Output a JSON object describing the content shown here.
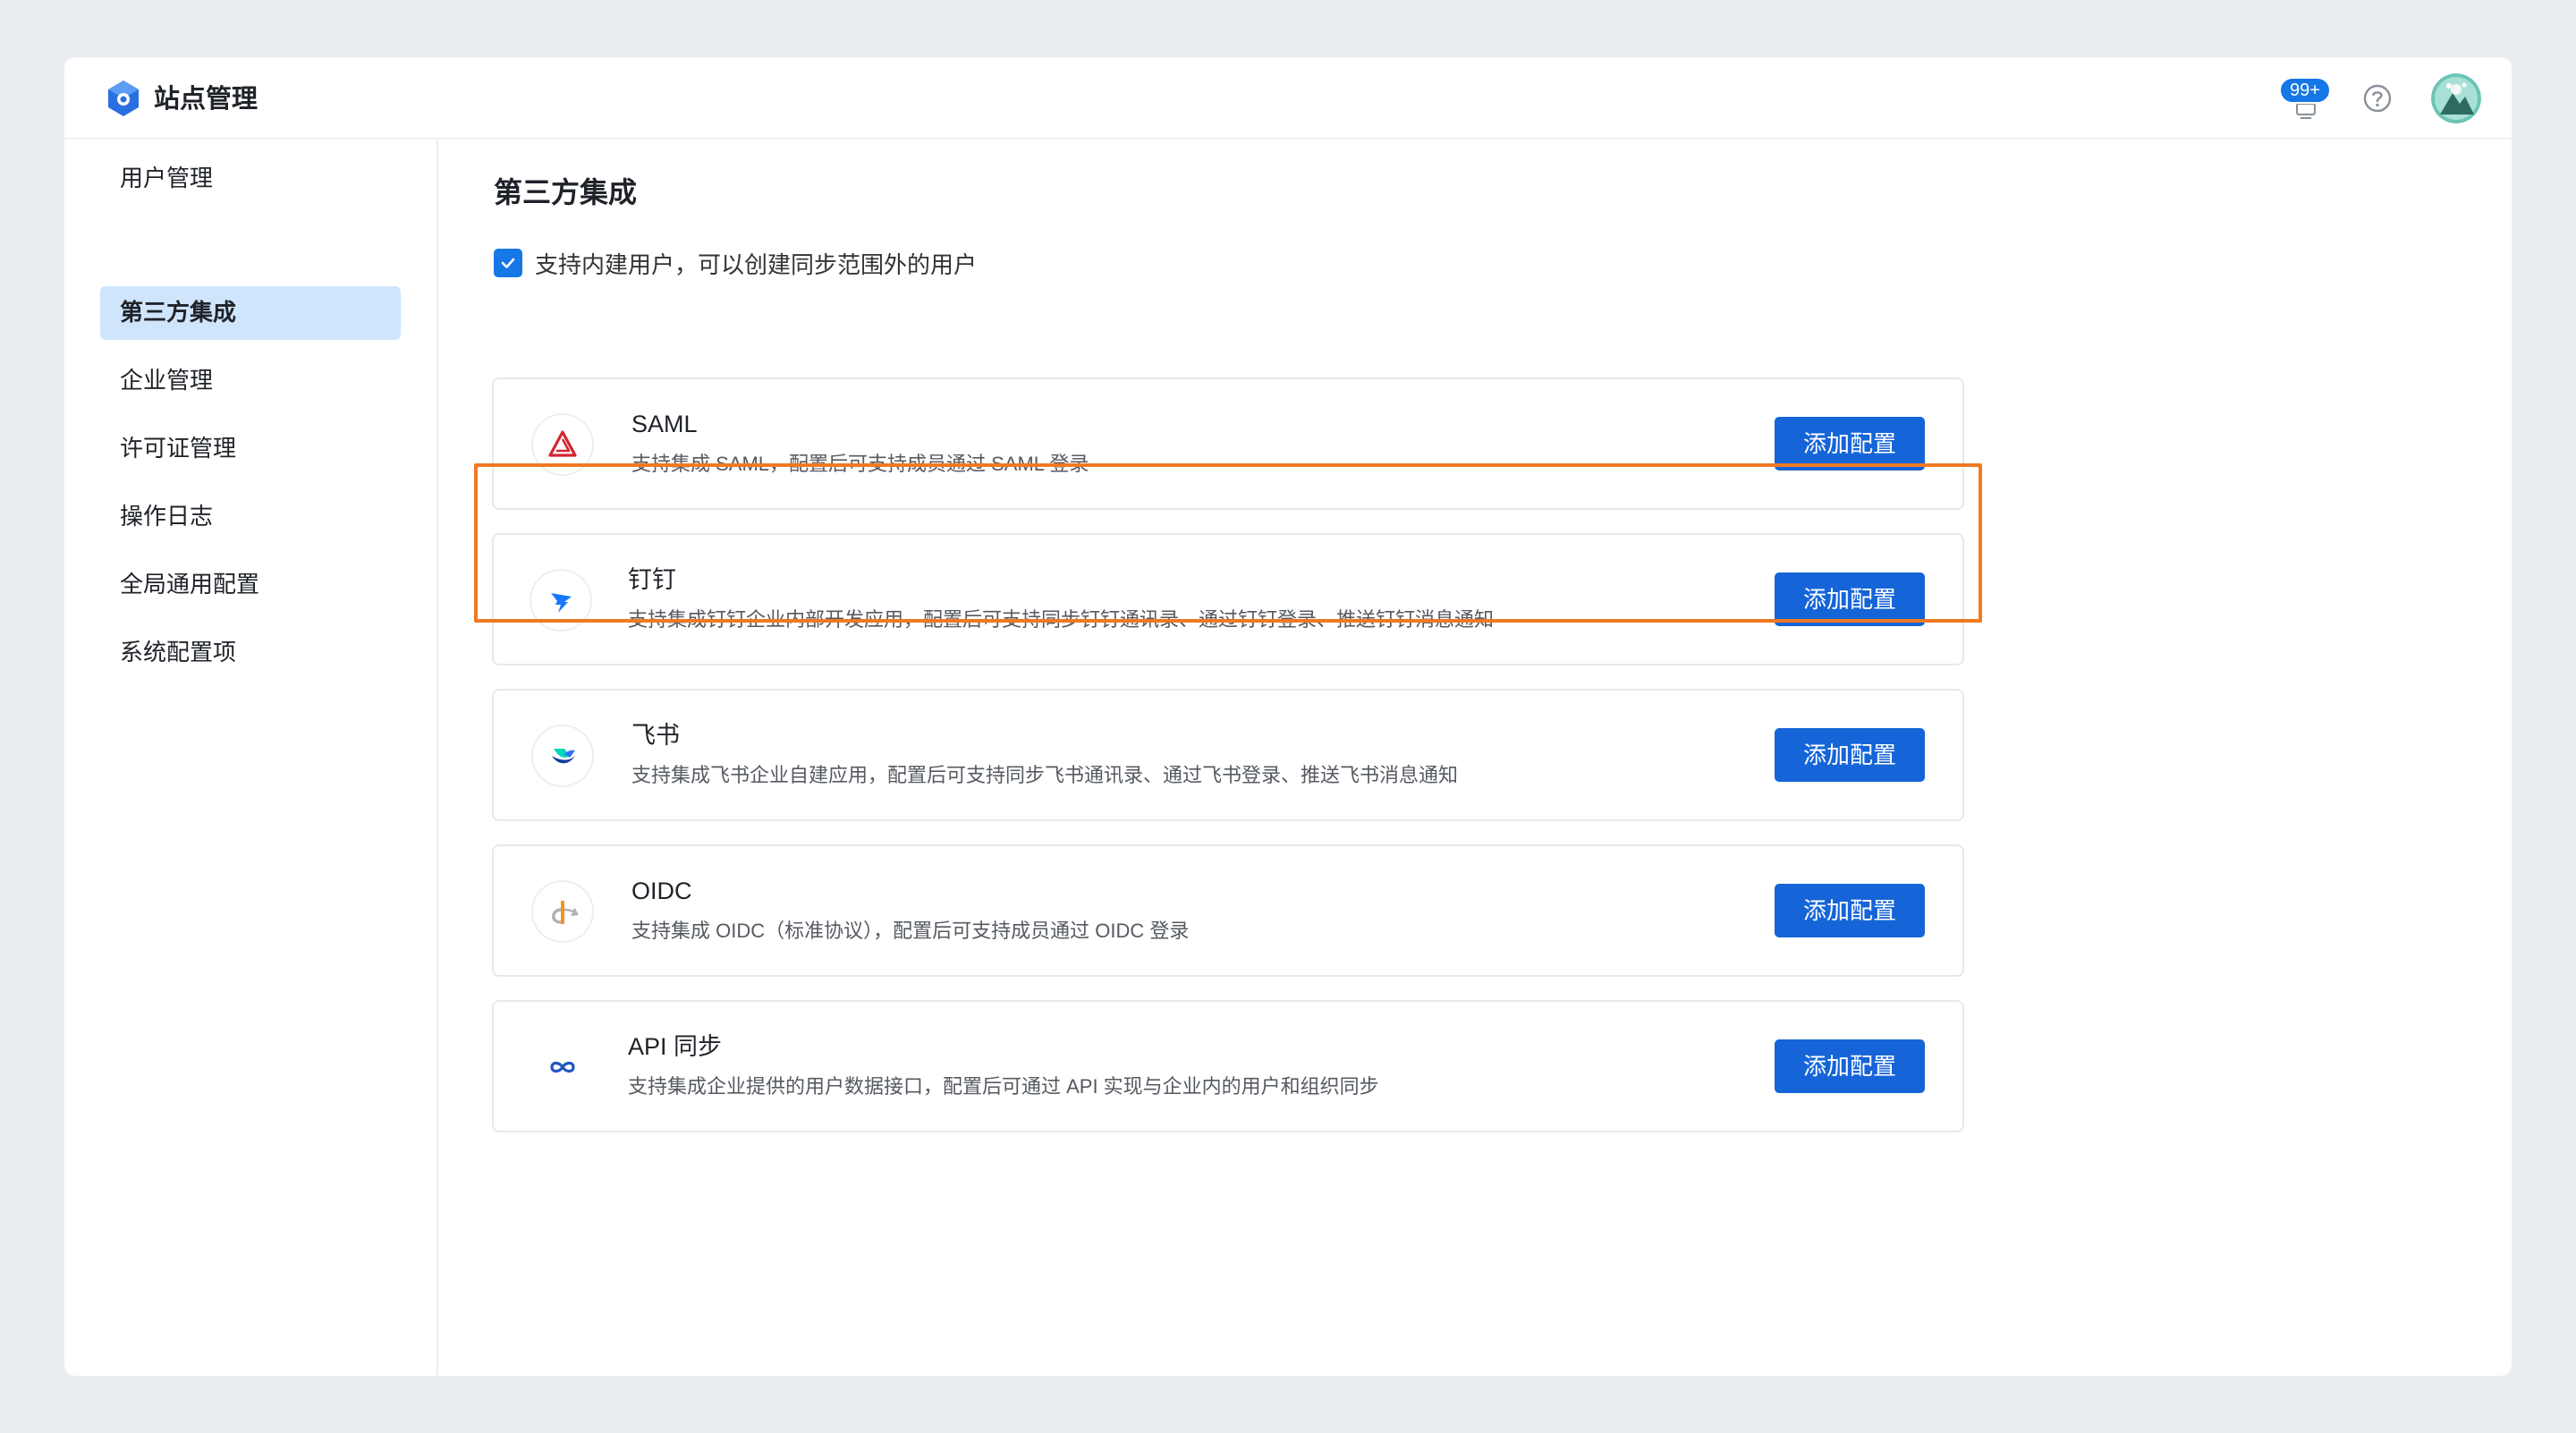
{
  "header": {
    "app_title": "站点管理",
    "notification_count": "99+",
    "icons": {
      "logo": "hexagon-logo-icon",
      "notification": "bell-icon",
      "help": "question-circle-icon",
      "avatar": "user-avatar"
    }
  },
  "sidebar": {
    "items": [
      {
        "label": "用户管理",
        "active": false
      },
      {
        "label": "第三方集成",
        "active": true
      },
      {
        "label": "企业管理",
        "active": false
      },
      {
        "label": "许可证管理",
        "active": false
      },
      {
        "label": "操作日志",
        "active": false
      },
      {
        "label": "全局通用配置",
        "active": false
      },
      {
        "label": "系统配置项",
        "active": false
      }
    ]
  },
  "main": {
    "title": "第三方集成",
    "checkbox": {
      "checked": true,
      "label": "支持内建用户，可以创建同步范围外的用户"
    },
    "integrations": [
      {
        "title": "SAML",
        "description": "支持集成 SAML，配置后可支持成员通过 SAML 登录",
        "button": "添加配置",
        "icon": "saml-icon"
      },
      {
        "title": "钉钉",
        "description": "支持集成钉钉企业内部开发应用，配置后可支持同步钉钉通讯录、通过钉钉登录、推送钉钉消息通知",
        "button": "添加配置",
        "icon": "dingtalk-icon"
      },
      {
        "title": "飞书",
        "description": "支持集成飞书企业自建应用，配置后可支持同步飞书通讯录、通过飞书登录、推送飞书消息通知",
        "button": "添加配置",
        "icon": "feishu-icon"
      },
      {
        "title": "OIDC",
        "description": "支持集成 OIDC（标准协议），配置后可支持成员通过 OIDC 登录",
        "button": "添加配置",
        "icon": "oidc-icon"
      },
      {
        "title": "API 同步",
        "description": "支持集成企业提供的用户数据接口，配置后可通过 API 实现与企业内的用户和组织同步",
        "button": "添加配置",
        "icon": "infinity-icon"
      }
    ]
  },
  "colors": {
    "primary": "#1565d8",
    "active_nav_bg": "#cfe5fb",
    "highlight_border": "#f07a22",
    "page_bg": "#e9edf1"
  }
}
